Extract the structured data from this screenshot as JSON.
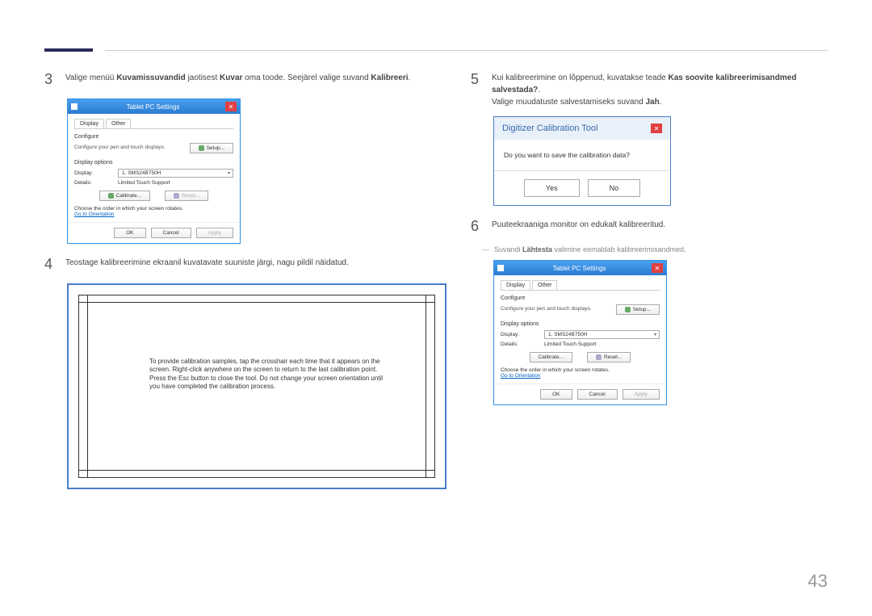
{
  "page_number": "43",
  "steps": {
    "s3": {
      "num": "3",
      "pre": "Valige menüü ",
      "b1": "Kuvamissuvandid",
      "mid1": " jaotisest ",
      "b2": "Kuvar",
      "mid2": " oma toode. Seejärel valige suvand ",
      "b3": "Kalibreeri",
      "post": "."
    },
    "s4": {
      "num": "4",
      "text": "Teostage kalibreerimine ekraanil kuvatavate suuniste järgi, nagu pildil näidatud."
    },
    "s5": {
      "num": "5",
      "pre": "Kui kalibreerimine on lõppenud, kuvatakse teade ",
      "b1": "Kas soovite kalibreerimisandmed salvestada?",
      "post": ".",
      "line2_pre": "Valige muudatuste salvestamiseks suvand ",
      "line2_b": "Jah",
      "line2_post": "."
    },
    "s6": {
      "num": "6",
      "text": "Puuteekraaniga monitor on edukalt kalibreeritud."
    }
  },
  "dash_note": {
    "pre": "Suvandi ",
    "b": "Lähtesta",
    "post": " valimine eemaldab kalibreerimisandmed."
  },
  "tablet_dialog": {
    "title": "Tablet PC Settings",
    "tab_display": "Display",
    "tab_other": "Other",
    "configure": "Configure",
    "configure_desc": "Configure your pen and touch displays.",
    "setup_btn": "Setup...",
    "display_options": "Display options",
    "display_label": "Display:",
    "display_val": "1. SMS24B750H",
    "details_label": "Details:",
    "details_val": "Limited Touch Support",
    "calibrate_btn": "Calibrate...",
    "reset_btn": "Reset...",
    "orient_note": "Choose the order in which your screen rotates.",
    "orient_link": "Go to Orientation",
    "ok": "OK",
    "cancel": "Cancel",
    "apply": "Apply"
  },
  "calib_screen": {
    "text": "To provide calibration samples, tap the crosshair each time that it appears on the screen.\nRight-click anywhere on the screen to return to the last calibration point. Press the Esc button to close the tool. Do not change your screen orientation until you have completed the calibration process."
  },
  "confirm": {
    "title": "Digitizer Calibration Tool",
    "close": "✕",
    "msg": "Do you want to save the calibration data?",
    "yes": "Yes",
    "no": "No"
  }
}
